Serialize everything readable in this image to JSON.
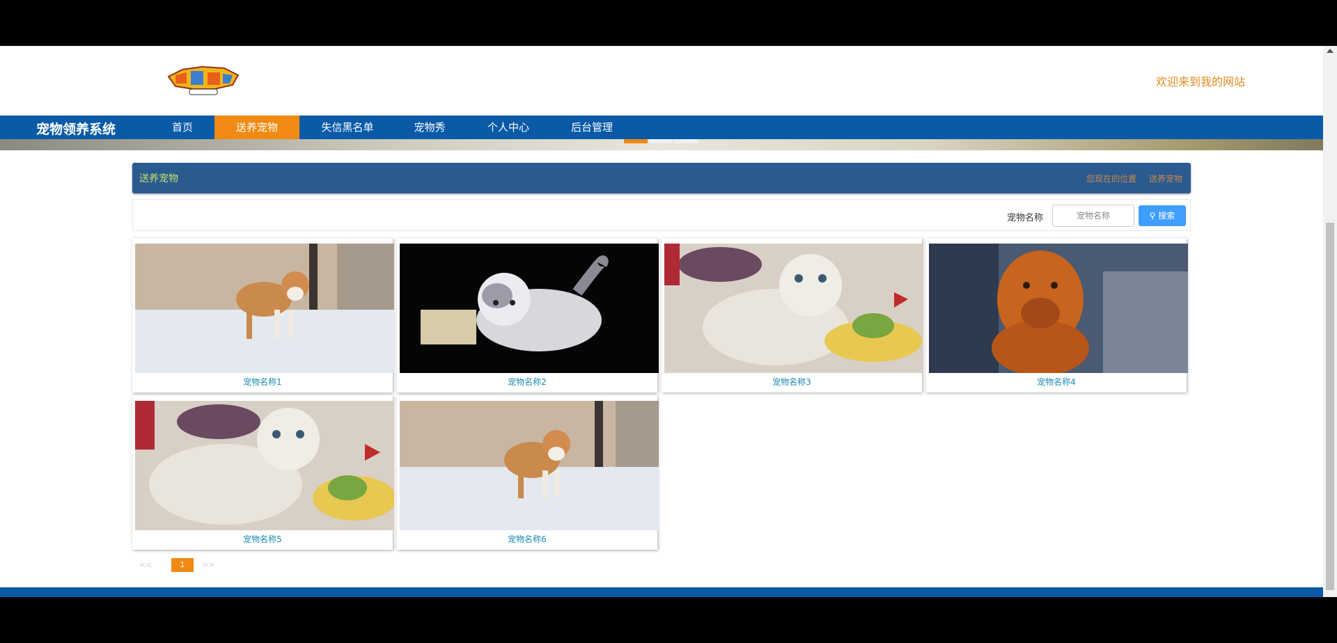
{
  "header": {
    "welcome": "欢迎来到我的网站"
  },
  "nav": {
    "brand": "宠物领养系统",
    "items": [
      {
        "label": "首页"
      },
      {
        "label": "送养宠物"
      },
      {
        "label": "失信黑名单"
      },
      {
        "label": "宠物秀"
      },
      {
        "label": "个人中心"
      },
      {
        "label": "后台管理"
      }
    ],
    "active_index": 1,
    "active_color": "#f08a12",
    "bar_color": "#0a5aa8"
  },
  "section": {
    "title": "送养宠物",
    "crumb_1": "您现在的位置",
    "crumb_2": "送养宠物"
  },
  "search": {
    "label": "宠物名称",
    "placeholder": "宠物名称",
    "button": "搜索",
    "button_icon": "search-icon"
  },
  "pets": [
    {
      "name": "宠物名称1",
      "image": "shiba-dog"
    },
    {
      "name": "宠物名称2",
      "image": "grey-kitten"
    },
    {
      "name": "宠物名称3",
      "image": "white-cat"
    },
    {
      "name": "宠物名称4",
      "image": "mastiff-dog"
    },
    {
      "name": "宠物名称5",
      "image": "white-cat"
    },
    {
      "name": "宠物名称6",
      "image": "shiba-dog"
    }
  ],
  "pager": {
    "current": "1"
  }
}
